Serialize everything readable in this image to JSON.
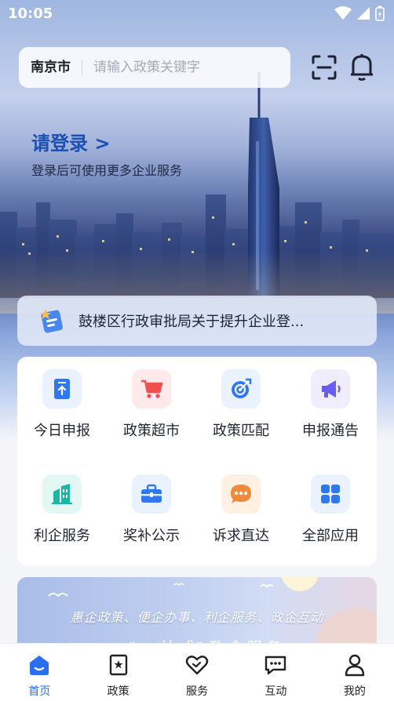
{
  "status_bar": {
    "time": "10:05"
  },
  "search": {
    "city": "南京市",
    "placeholder": "请输入政策关键字"
  },
  "login": {
    "title": "请登录 >",
    "subtitle": "登录后可使用更多企业服务"
  },
  "notice": {
    "text": "鼓楼区行政审批局关于提升企业登..."
  },
  "grid": {
    "items": [
      {
        "label": "今日申报",
        "icon": "document-upload-icon"
      },
      {
        "label": "政策超市",
        "icon": "shopping-cart-icon"
      },
      {
        "label": "政策匹配",
        "icon": "target-icon"
      },
      {
        "label": "申报通告",
        "icon": "megaphone-icon"
      },
      {
        "label": "利企服务",
        "icon": "buildings-icon"
      },
      {
        "label": "奖补公示",
        "icon": "briefcase-icon"
      },
      {
        "label": "诉求直达",
        "icon": "chat-bubble-icon"
      },
      {
        "label": "全部应用",
        "icon": "apps-grid-icon"
      }
    ]
  },
  "banner": {
    "slogan": "惠企政策、便企办事、利企服务、政企互动",
    "slogan2": "“一站式”政企服务"
  },
  "bottom_nav": {
    "items": [
      {
        "label": "首页",
        "icon": "home-icon",
        "active": true
      },
      {
        "label": "政策",
        "icon": "policy-book-icon",
        "active": false
      },
      {
        "label": "服务",
        "icon": "heart-service-icon",
        "active": false
      },
      {
        "label": "互动",
        "icon": "chat-icon",
        "active": false
      },
      {
        "label": "我的",
        "icon": "user-icon",
        "active": false
      }
    ]
  },
  "colors": {
    "primary": "#2b6ef2",
    "login_title": "#1b4fb3",
    "icon_blue": "#2f78f0",
    "icon_red": "#ef4f4f",
    "icon_purple": "#6a5cf0",
    "icon_teal": "#20b4a5",
    "icon_orange": "#f08a3a"
  }
}
